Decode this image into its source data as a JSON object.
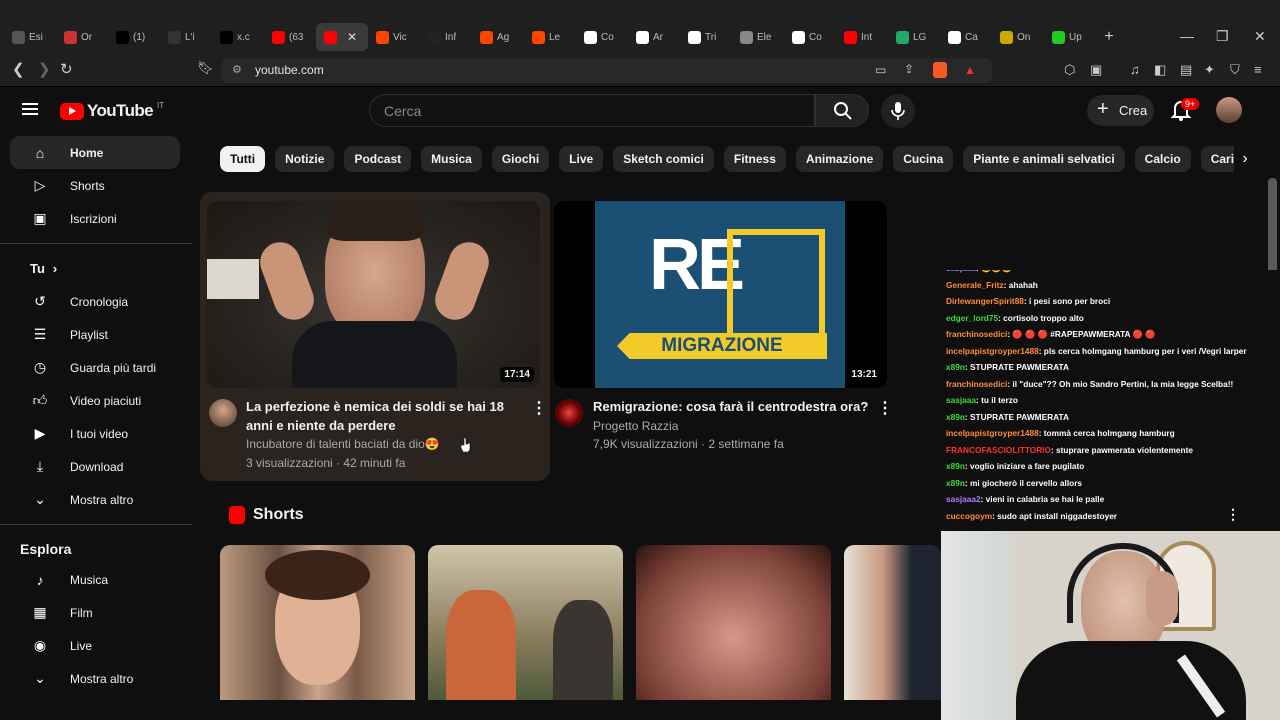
{
  "browser": {
    "tabs": [
      {
        "label": "Esi",
        "color": "#555"
      },
      {
        "label": "Or",
        "color": "#c33"
      },
      {
        "label": "(1)",
        "color": "#000"
      },
      {
        "label": "L'i",
        "color": "#333"
      },
      {
        "label": "x.c",
        "color": "#000"
      },
      {
        "label": "(63",
        "color": "#f00"
      },
      {
        "label": "",
        "color": "#f00",
        "active": true
      },
      {
        "label": "Vic",
        "color": "#ff4500"
      },
      {
        "label": "Inf",
        "color": "#222"
      },
      {
        "label": "Ag",
        "color": "#ff4500"
      },
      {
        "label": "Le",
        "color": "#ff4500"
      },
      {
        "label": "Co",
        "color": "#fff"
      },
      {
        "label": "Ar",
        "color": "#fff"
      },
      {
        "label": "Tri",
        "color": "#fff"
      },
      {
        "label": "Ele",
        "color": "#888"
      },
      {
        "label": "Co",
        "color": "#fff"
      },
      {
        "label": "Int",
        "color": "#f00"
      },
      {
        "label": "LG",
        "color": "#2a6"
      },
      {
        "label": "Ca",
        "color": "#fff"
      },
      {
        "label": "On",
        "color": "#ca0"
      },
      {
        "label": "Up",
        "color": "#2c2"
      }
    ],
    "url": "youtube.com"
  },
  "youtube": {
    "logo_text": "YouTube",
    "country": "IT",
    "search_placeholder": "Cerca",
    "create_label": "Crea",
    "notif_count": "9+",
    "sidebar": {
      "main": [
        {
          "label": "Home",
          "icon": "home-icon",
          "active": true
        },
        {
          "label": "Shorts",
          "icon": "shorts-icon"
        },
        {
          "label": "Iscrizioni",
          "icon": "subscriptions-icon"
        }
      ],
      "you_label": "Tu",
      "you": [
        {
          "label": "Cronologia",
          "icon": "history-icon"
        },
        {
          "label": "Playlist",
          "icon": "playlist-icon"
        },
        {
          "label": "Guarda più tardi",
          "icon": "watch-later-icon"
        },
        {
          "label": "Video piaciuti",
          "icon": "like-icon"
        },
        {
          "label": "I tuoi video",
          "icon": "your-videos-icon"
        },
        {
          "label": "Download",
          "icon": "download-icon"
        },
        {
          "label": "Mostra altro",
          "icon": "chevron-down-icon"
        }
      ],
      "explore_label": "Esplora",
      "explore": [
        {
          "label": "Musica",
          "icon": "music-icon"
        },
        {
          "label": "Film",
          "icon": "film-icon"
        },
        {
          "label": "Live",
          "icon": "live-icon"
        },
        {
          "label": "Mostra altro",
          "icon": "chevron-down-icon"
        }
      ]
    },
    "chips": [
      "Tutti",
      "Notizie",
      "Podcast",
      "Musica",
      "Giochi",
      "Live",
      "Sketch comici",
      "Fitness",
      "Animazione",
      "Cucina",
      "Piante e animali selvatici",
      "Calcio",
      "Caricamenti recenti"
    ],
    "videos": [
      {
        "title_line1": "La perfezione è nemica dei soldi se hai 18",
        "title_line2": "anni e niente da perdere",
        "channel": "Incubatore di talenti baciati da dio😍",
        "meta": "3 visualizzazioni · 42 minuti fa",
        "duration": "17:14"
      },
      {
        "title_line1": "Remigrazione: cosa farà il centrodestra ora?",
        "title_line2": "",
        "channel": "Progetto Razzia",
        "meta": "7,9K visualizzazioni · 2 settimane fa",
        "duration": "13:21",
        "thumb_text_top": "RE",
        "thumb_text_bottom": "MIGRAZIONE"
      }
    ],
    "shorts_label": "Shorts"
  },
  "chat": [
    {
      "user": "sasjaaa",
      "msg": ": 😀😀😀",
      "color": "#b07cff"
    },
    {
      "user": "Generale_Fritz",
      "msg": ": ahahah",
      "color": "#ff8c3a"
    },
    {
      "user": "DirlewangerSpirit88",
      "msg": ": i pesi sono per broci",
      "color": "#ff8c3a"
    },
    {
      "user": "edger_lord75",
      "msg": ": cortisolo troppo alto",
      "color": "#3adb3a"
    },
    {
      "user": "franchinosedici",
      "msg": ": 🔴 🔴 🔴 #RAPEPAWMERATA 🔴 🔴",
      "color": "#ff8c3a"
    },
    {
      "user": "incelpapistgroyper1488",
      "msg": ": pls cerca holmgang hamburg per i veri /Vegri larper",
      "color": "#ff8c3a"
    },
    {
      "user": "x89n",
      "msg": ": STUPRATE PAWMERATA",
      "color": "#3adb3a"
    },
    {
      "user": "franchinosedici",
      "msg": ": il \"duce\"?? Oh mio Sandro Pertini, la mia legge Scelba!!",
      "color": "#ff8c3a"
    },
    {
      "user": "sasjaaa",
      "msg": ": tu il terzo",
      "color": "#3adb3a"
    },
    {
      "user": "x89n",
      "msg": ": STUPRATE PAWMERATA",
      "color": "#3adb3a"
    },
    {
      "user": "incelpapistgroyper1488",
      "msg": ": tommà cerca holmgang hamburg",
      "color": "#ff8c3a"
    },
    {
      "user": "FRANCOFASCIOLITTORIO",
      "msg": ": stuprare pawmerata violentemente",
      "color": "#ff3030"
    },
    {
      "user": "x89n",
      "msg": ": voglio iniziare a fare pugilato",
      "color": "#3adb3a"
    },
    {
      "user": "x89n",
      "msg": ": mi giocherò il cervello allors",
      "color": "#3adb3a"
    },
    {
      "user": "sasjaaa2",
      "msg": ": vieni in calabria se hai le palle",
      "color": "#b07cff"
    },
    {
      "user": "cuccogoym",
      "msg": ": sudo apt install niggadestoyer",
      "color": "#ff8c3a"
    }
  ]
}
